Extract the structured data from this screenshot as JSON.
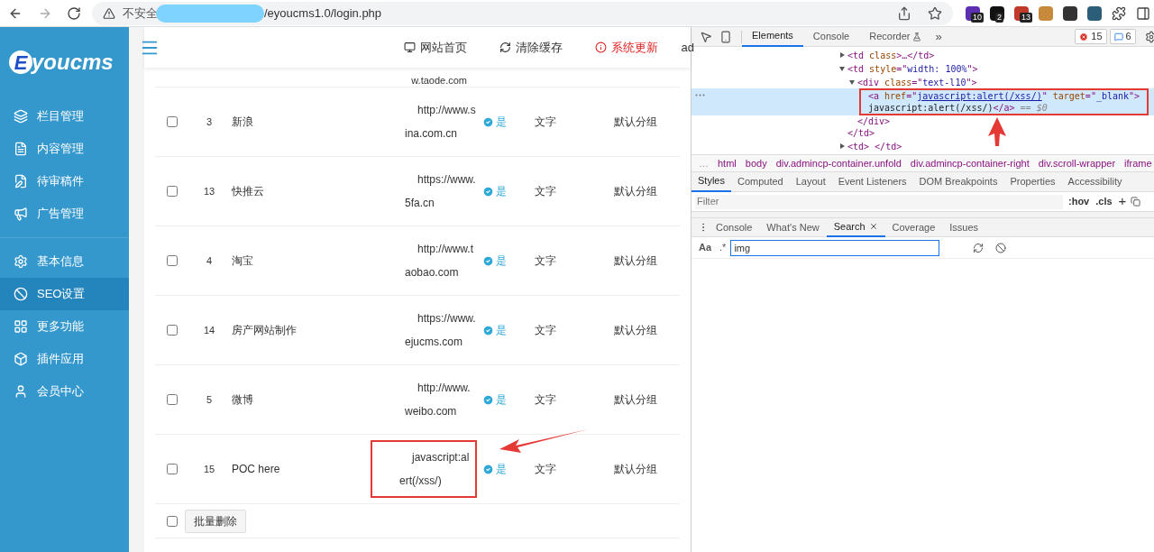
{
  "browser": {
    "security": "不安全",
    "url": "/eyoucms1.0/login.php",
    "extensions": [
      {
        "badge": "10",
        "color": "#5b2fb0"
      },
      {
        "badge": "2",
        "color": "#111111"
      },
      {
        "badge": "13",
        "color": "#c0392b"
      },
      {
        "color": "#c88a3a"
      },
      {
        "color": "#333333"
      },
      {
        "color": "#2c5e7a"
      }
    ]
  },
  "logo": {
    "initial": "E",
    "text": "youcms"
  },
  "sidebar": {
    "groups": [
      [
        {
          "label": "栏目管理",
          "selected": false
        },
        {
          "label": "内容管理",
          "selected": false
        },
        {
          "label": "待审稿件",
          "selected": false
        },
        {
          "label": "广告管理",
          "selected": false
        }
      ],
      [
        {
          "label": "基本信息",
          "selected": false
        },
        {
          "label": "SEO设置",
          "selected": true
        },
        {
          "label": "更多功能",
          "selected": false
        },
        {
          "label": "插件应用",
          "selected": false
        },
        {
          "label": "会员中心",
          "selected": false
        }
      ]
    ]
  },
  "header": {
    "links": [
      {
        "label": "网站首页",
        "alert": false
      },
      {
        "label": "清除缓存",
        "alert": false
      },
      {
        "label": "系统更新",
        "alert": true
      }
    ],
    "user": "ad"
  },
  "table": {
    "partial_row_url": "w.taode.com",
    "rows": [
      {
        "checked": false,
        "id": "3",
        "name": "新浪",
        "url": "http://www.sina.com.cn",
        "shown": "是",
        "type": "文字",
        "group": "默认分组",
        "highlighted": false
      },
      {
        "checked": false,
        "id": "13",
        "name": "快推云",
        "url": "https://www.5fa.cn",
        "shown": "是",
        "type": "文字",
        "group": "默认分组",
        "highlighted": false
      },
      {
        "checked": false,
        "id": "4",
        "name": "淘宝",
        "url": "http://www.taobao.com",
        "shown": "是",
        "type": "文字",
        "group": "默认分组",
        "highlighted": false
      },
      {
        "checked": false,
        "id": "14",
        "name": "房产网站制作",
        "url": "https://www.ejucms.com",
        "shown": "是",
        "type": "文字",
        "group": "默认分组",
        "highlighted": false
      },
      {
        "checked": false,
        "id": "5",
        "name": "微博",
        "url": "http://www.weibo.com",
        "shown": "是",
        "type": "文字",
        "group": "默认分组",
        "highlighted": false
      },
      {
        "checked": false,
        "id": "15",
        "name": "POC here",
        "url": "javascript:alert(/xss/)",
        "shown": "是",
        "type": "文字",
        "group": "默认分组",
        "highlighted": true
      }
    ],
    "footer": {
      "checked": false,
      "button": "批量删除"
    }
  },
  "devtools": {
    "tabs": [
      {
        "label": "Elements",
        "selected": true
      },
      {
        "label": "Console",
        "selected": false
      },
      {
        "label": "Recorder",
        "selected": false
      }
    ],
    "more": "»",
    "errors": "15",
    "messages": "6",
    "tree": [
      {
        "expanded": false,
        "selected": false,
        "highlighted": false,
        "lines": [
          [
            {
              "kind": "tag",
              "text": "<td "
            },
            {
              "kind": "attr",
              "text": "class"
            },
            {
              "kind": "tag",
              "text": ">…</td>"
            }
          ]
        ]
      },
      {
        "expanded": true,
        "selected": false,
        "highlighted": false,
        "lines": [
          [
            {
              "kind": "tag",
              "text": "<td "
            },
            {
              "kind": "attr",
              "text": "style"
            },
            {
              "kind": "tag",
              "text": "=\""
            },
            {
              "kind": "value",
              "text": "width: 100%"
            },
            {
              "kind": "tag",
              "text": "\">"
            }
          ]
        ],
        "closing": "</td>",
        "children": [
          {
            "expanded": true,
            "selected": false,
            "highlighted": false,
            "lines": [
              [
                {
                  "kind": "tag",
                  "text": "<div "
                },
                {
                  "kind": "attr",
                  "text": "class"
                },
                {
                  "kind": "tag",
                  "text": "=\""
                },
                {
                  "kind": "value",
                  "text": "text-l10"
                },
                {
                  "kind": "tag",
                  "text": "\">"
                }
              ]
            ],
            "closing": "</div>",
            "children": [
              {
                "selected": true,
                "highlighted": true,
                "lines": [
                  [
                    {
                      "kind": "tag",
                      "text": "<a "
                    },
                    {
                      "kind": "attr",
                      "text": "href"
                    },
                    {
                      "kind": "tag",
                      "text": "=\""
                    },
                    {
                      "kind": "link",
                      "text": "javascript:alert(/xss/)"
                    },
                    {
                      "kind": "tag",
                      "text": "\" "
                    },
                    {
                      "kind": "attr",
                      "text": "target"
                    },
                    {
                      "kind": "tag",
                      "text": "=\""
                    },
                    {
                      "kind": "value",
                      "text": "_blank"
                    },
                    {
                      "kind": "tag",
                      "text": "\">"
                    }
                  ],
                  [
                    {
                      "kind": "text",
                      "text": "javascript:alert(/xss/)"
                    },
                    {
                      "kind": "tag",
                      "text": "</a>"
                    },
                    {
                      "kind": "note",
                      "text": " == $0"
                    }
                  ]
                ]
              }
            ]
          }
        ]
      },
      {
        "expanded": false,
        "selected": false,
        "highlighted": false,
        "lines": [
          [
            {
              "kind": "tag",
              "text": "<td> </td>"
            }
          ]
        ]
      }
    ],
    "breadcrumbs": [
      "…",
      "html",
      "body",
      "div.admincp-container.unfold",
      "div.admincp-container-right",
      "div.scroll-wrapper",
      "iframe"
    ],
    "style_tabs": [
      {
        "label": "Styles",
        "selected": true
      },
      {
        "label": "Computed",
        "selected": false
      },
      {
        "label": "Layout",
        "selected": false
      },
      {
        "label": "Event Listeners",
        "selected": false
      },
      {
        "label": "DOM Breakpoints",
        "selected": false
      },
      {
        "label": "Properties",
        "selected": false
      },
      {
        "label": "Accessibility",
        "selected": false
      }
    ],
    "filter": {
      "placeholder": "Filter",
      "hov": ":hov",
      "cls": ".cls",
      "add": "+"
    },
    "drawer_tabs": [
      {
        "label": "Console",
        "selected": false,
        "closable": false
      },
      {
        "label": "What's New",
        "selected": false,
        "closable": false
      },
      {
        "label": "Search",
        "selected": true,
        "closable": true
      },
      {
        "label": "Coverage",
        "selected": false,
        "closable": false
      },
      {
        "label": "Issues",
        "selected": false,
        "closable": false
      }
    ],
    "search": {
      "case": "Aa",
      "regex": ".*",
      "value": "img"
    }
  }
}
